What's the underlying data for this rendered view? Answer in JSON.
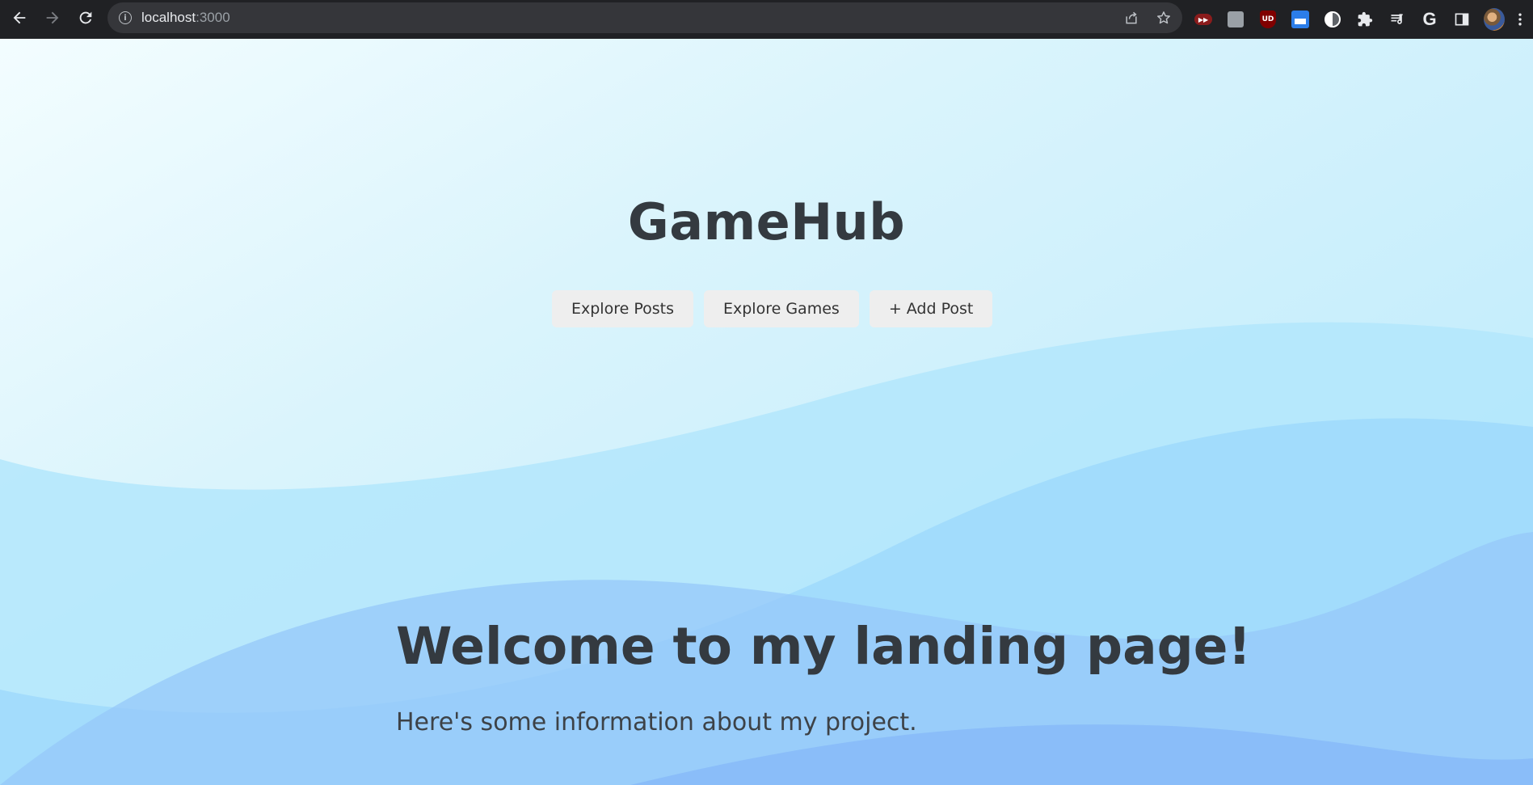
{
  "browser": {
    "url_host": "localhost",
    "url_port": ":3000",
    "back_icon": "arrow-left-icon",
    "forward_icon": "arrow-right-icon",
    "reload_icon": "reload-icon",
    "site_info_icon": "info-icon",
    "share_icon": "share-icon",
    "bookmark_icon": "star-icon",
    "extensions": [
      "red-extension-icon",
      "gray-extension-icon",
      "ublock-icon",
      "blue-window-extension-icon",
      "half-circle-extension-icon",
      "puzzle-extensions-icon",
      "media-queue-icon",
      "google-icon",
      "side-panel-icon",
      "profile-avatar",
      "menu-kebab-icon"
    ],
    "google_letter": "G",
    "ublock_label": "UD"
  },
  "page": {
    "site_title": "GameHub",
    "nav": {
      "explore_posts": "Explore Posts",
      "explore_games": "Explore Games",
      "add_post": "+ Add Post"
    },
    "hero_title": "Welcome to my landing page!",
    "hero_subtitle": "Here's some information about my project."
  },
  "colors": {
    "chrome_bg": "#202124",
    "omnibox_bg": "#35363a",
    "heading": "#343a40",
    "button_bg": "#eeeeee",
    "wave_light": "#b3e6fb",
    "wave_mid": "#9bd5fb",
    "wave_deep": "#86baf9"
  }
}
